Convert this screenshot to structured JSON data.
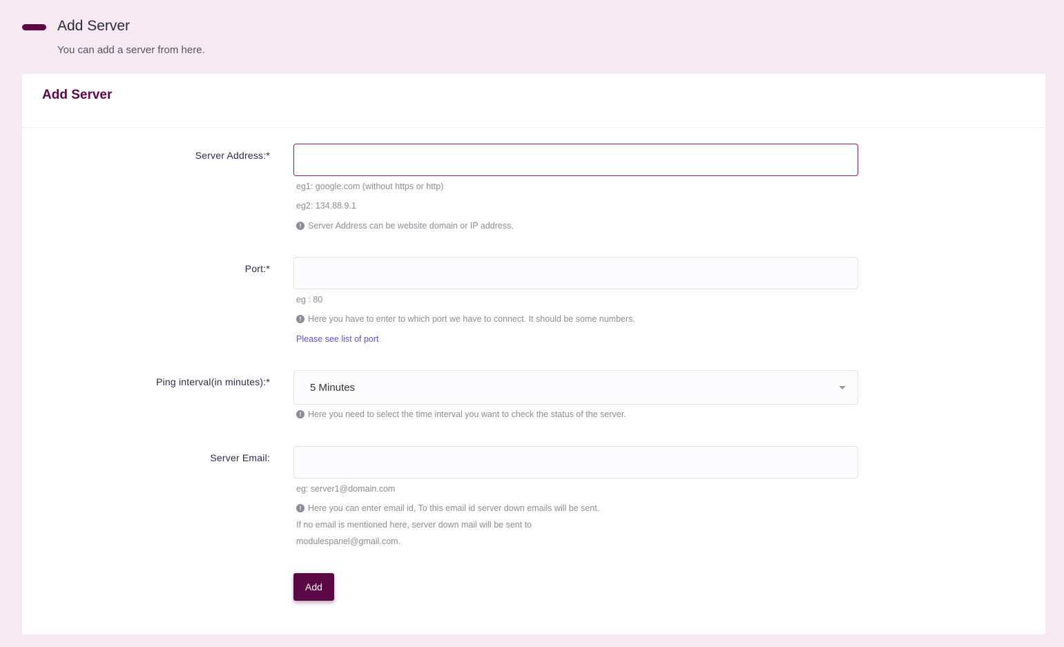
{
  "header": {
    "title": "Add Server",
    "subtitle": "You can add a server from here."
  },
  "card": {
    "title": "Add Server"
  },
  "form": {
    "server_address": {
      "label": "Server Address:*",
      "value": "",
      "hint1": "eg1: google.com (without https or http)",
      "hint2": "eg2: 134.88.9.1",
      "info": "Server Address can be website domain or IP address."
    },
    "port": {
      "label": "Port:*",
      "value": "",
      "hint": "eg : 80",
      "info": "Here you have to enter to which port we have to connect. It should be some numbers.",
      "link": "Please see list of port"
    },
    "ping_interval": {
      "label": "Ping interval(in minutes):*",
      "selected": "5 Minutes",
      "info": "Here you need to select the time interval you want to check the status of the server."
    },
    "server_email": {
      "label": "Server Email:",
      "value": "",
      "hint": "eg: server1@domain.com",
      "info": "Here you can enter email id, To this email id server down emails will be sent.",
      "note1": "If no email is mentioned here, server down mail will be sent to",
      "note2": "modulespanel@gmail.com."
    },
    "submit_label": "Add"
  },
  "colors": {
    "background": "#f6e9f2",
    "accent": "#5c0745",
    "link": "#5a55c9",
    "focus_border": "#8a1f73"
  },
  "icons": {
    "info": "info-circle-icon",
    "dropdown": "chevron-down-icon"
  }
}
